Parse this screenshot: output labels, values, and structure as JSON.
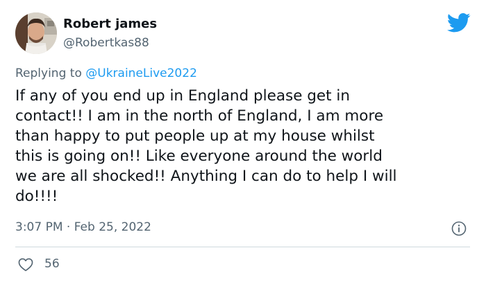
{
  "author": {
    "name": "Robert james",
    "handle": "@Robertkas88"
  },
  "reply": {
    "prefix": "Replying to ",
    "mention": "@UkraineLive2022"
  },
  "tweet": {
    "text": "If any of you end up in England please get in\ncontact!! I am in the north of England, I am more\nthan happy to put people up at my house whilst\nthis is going on!! Like everyone around the world\nwe are all shocked!! Anything I can do to help I will\ndo!!!!",
    "timestamp": "3:07 PM · Feb 25, 2022",
    "likes": "56"
  },
  "icons": {
    "brand": "twitter-bird-icon",
    "info": "info-icon",
    "like": "heart-icon"
  },
  "colors": {
    "brand": "#1d9bf0",
    "text": "#0f1419",
    "secondary": "#536471",
    "divider": "#cfd9de"
  }
}
